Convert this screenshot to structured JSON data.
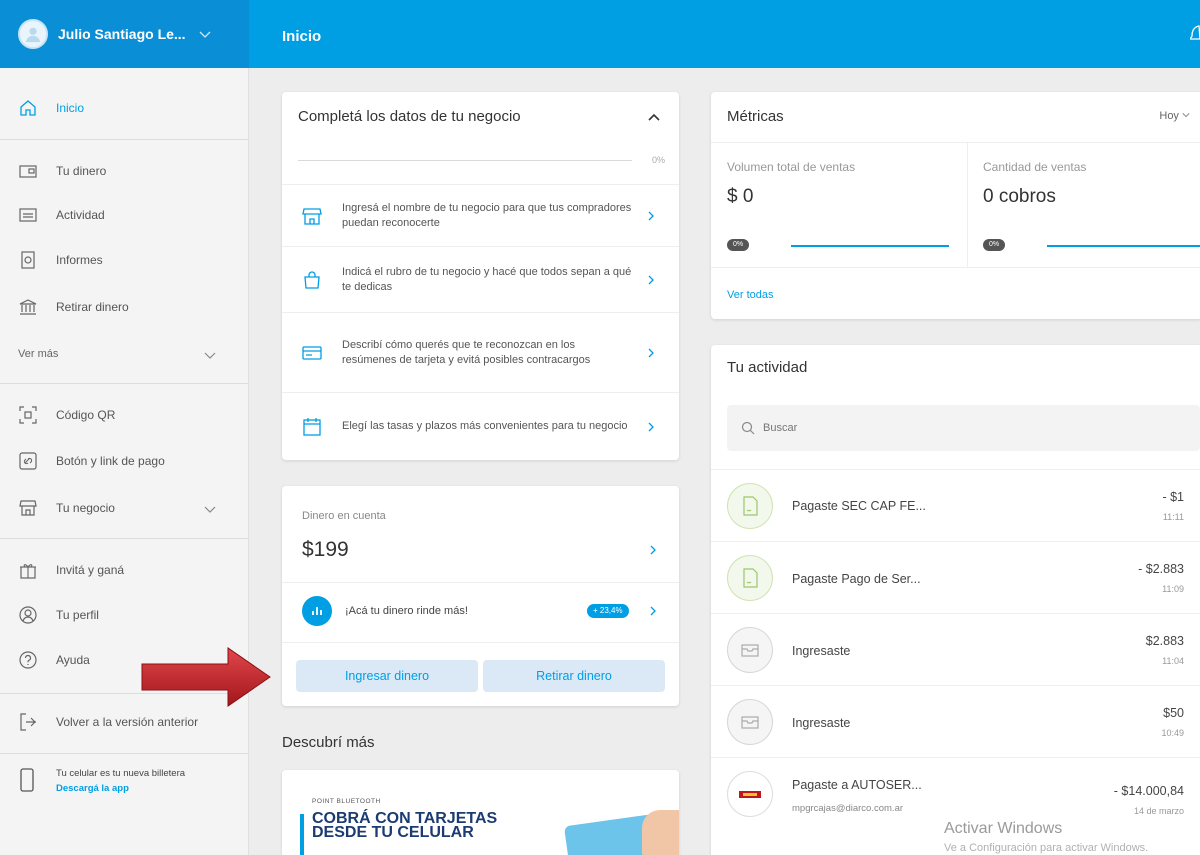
{
  "header": {
    "user_name": "Julio Santiago Le...",
    "page_title": "Inicio"
  },
  "sidebar": {
    "items": [
      {
        "label": "Inicio"
      },
      {
        "label": "Tu dinero"
      },
      {
        "label": "Actividad"
      },
      {
        "label": "Informes"
      },
      {
        "label": "Retirar dinero"
      },
      {
        "label": "Código QR"
      },
      {
        "label": "Botón y link de pago"
      },
      {
        "label": "Tu negocio"
      },
      {
        "label": "Invitá y ganá"
      },
      {
        "label": "Tu perfil"
      },
      {
        "label": "Ayuda"
      },
      {
        "label": "Volver a la versión anterior"
      }
    ],
    "ver_mas": "Ver más",
    "promo_text": "Tu celular es tu nueva billetera",
    "promo_link": "Descargá la app"
  },
  "completa": {
    "title": "Completá los datos de tu negocio",
    "progress_pct": "0%",
    "tasks": [
      {
        "text": "Ingresá el nombre de tu negocio para que tus compradores puedan reconocerte"
      },
      {
        "text": "Indicá el rubro de tu negocio y hacé que todos sepan a qué te dedicas"
      },
      {
        "text": "Describí cómo querés que te reconozcan en los resúmenes de tarjeta y evitá posibles contracargos"
      },
      {
        "text": "Elegí las tasas y plazos más convenientes para tu negocio"
      }
    ]
  },
  "dinero": {
    "label": "Dinero en cuenta",
    "amount": "$199",
    "rinde_text": "¡Acá tu dinero rinde más!",
    "rinde_badge": "+ 23,4%",
    "btn_ingresar": "Ingresar dinero",
    "btn_retirar": "Retirar dinero"
  },
  "descubri": {
    "title": "Descubrí más",
    "promo_small": "POINT BLUETOOTH",
    "promo_big": "COBRÁ CON TARJETAS DESDE TU CELULAR"
  },
  "metricas": {
    "title": "Métricas",
    "period": "Hoy",
    "vol_label": "Volumen total de ventas",
    "vol_value": "$ 0",
    "vol_pct": "0%",
    "cant_label": "Cantidad de ventas",
    "cant_value": "0 cobros",
    "cant_pct": "0%",
    "ver_todas": "Ver todas"
  },
  "actividad": {
    "title": "Tu actividad",
    "search_placeholder": "Buscar",
    "rows": [
      {
        "name": "Pagaste SEC CAP FE...",
        "amount": "- $1",
        "time": "11:11"
      },
      {
        "name": "Pagaste Pago de Ser...",
        "amount": "- $2.883",
        "time": "11:09"
      },
      {
        "name": "Ingresaste",
        "amount": "$2.883",
        "time": "11:04"
      },
      {
        "name": "Ingresaste",
        "amount": "$50",
        "time": "10:49"
      },
      {
        "name": "Pagaste a AUTOSER...",
        "sub": "mpgrcajas@diarco.com.ar",
        "amount": "- $14.000,84",
        "time": "14 de marzo"
      }
    ]
  },
  "watermark": {
    "line1": "Activar Windows",
    "line2": "Ve a Configuración para activar Windows."
  },
  "colors": {
    "brand": "#009ee3",
    "arrow": "#c0272d"
  }
}
